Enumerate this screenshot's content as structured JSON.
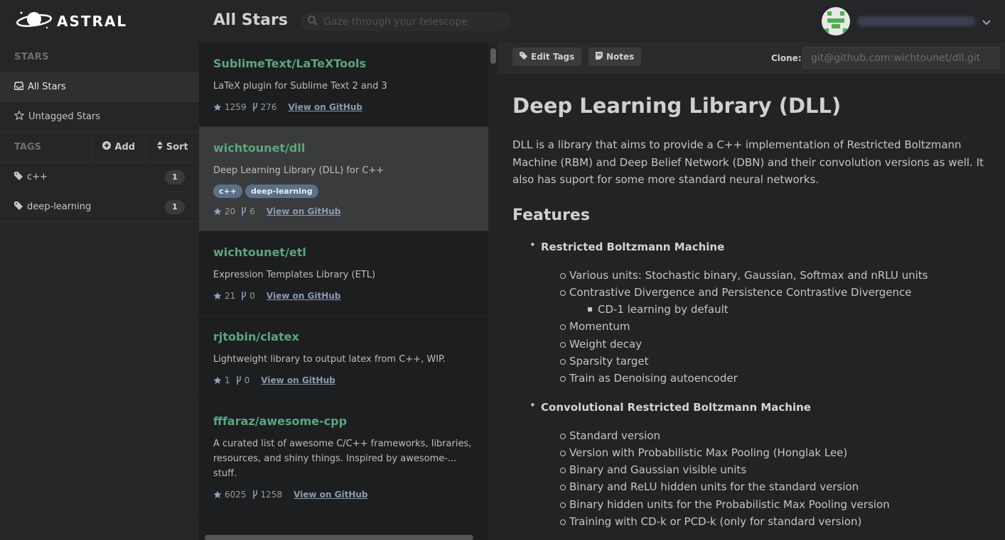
{
  "brand": {
    "name": "ASTRAL"
  },
  "header": {
    "title": "All Stars",
    "search_placeholder": "Gaze through your telescope"
  },
  "sidebar": {
    "stars_heading": "STARS",
    "items": [
      {
        "label": "All Stars",
        "icon": "inbox-icon",
        "active": true
      },
      {
        "label": "Untagged Stars",
        "icon": "star-outline-icon"
      }
    ],
    "tags_heading": "TAGS",
    "add_label": "Add",
    "sort_label": "Sort",
    "tags": [
      {
        "label": "c++",
        "count": "1"
      },
      {
        "label": "deep-learning",
        "count": "1"
      }
    ]
  },
  "repos": [
    {
      "name": "SublimeText/LaTeXTools",
      "description": "LaTeX plugin for Sublime Text 2 and 3",
      "stars": "1259",
      "forks": "276",
      "link": "View on GitHub",
      "tags": []
    },
    {
      "name": "wichtounet/dll",
      "description": "Deep Learning Library (DLL) for C++",
      "stars": "20",
      "forks": "6",
      "link": "View on GitHub",
      "tags": [
        "c++",
        "deep-learning"
      ],
      "selected": true
    },
    {
      "name": "wichtounet/etl",
      "description": "Expression Templates Library (ETL)",
      "stars": "21",
      "forks": "0",
      "link": "View on GitHub",
      "tags": []
    },
    {
      "name": "rjtobin/clatex",
      "description": "Lightweight library to output latex from C++, WIP.",
      "stars": "1",
      "forks": "0",
      "link": "View on GitHub",
      "tags": []
    },
    {
      "name": "fffaraz/awesome-cpp",
      "description": "A curated list of awesome C/C++ frameworks, libraries, resources, and shiny things. Inspired by awesome-... stuff.",
      "stars": "6025",
      "forks": "1258",
      "link": "View on GitHub",
      "tags": []
    }
  ],
  "detail": {
    "edit_tags_label": "Edit Tags",
    "notes_label": "Notes",
    "clone_label": "Clone:",
    "clone_url": "git@github.com:wichtounet/dll.git",
    "title": "Deep Learning Library (DLL)",
    "intro": "DLL is a library that aims to provide a C++ implementation of Restricted Boltzmann Machine (RBM) and Deep Belief Network (DBN) and their convolution versions as well. It also has suport for some more standard neural networks.",
    "features_heading": "Features",
    "sections": [
      {
        "title": "Restricted Boltzmann Machine",
        "items": [
          {
            "text": "Various units: Stochastic binary, Gaussian, Softmax and nRLU units"
          },
          {
            "text": "Contrastive Divergence and Persistence Contrastive Divergence",
            "sub": [
              "CD-1 learning by default"
            ]
          },
          {
            "text": "Momentum"
          },
          {
            "text": "Weight decay"
          },
          {
            "text": "Sparsity target"
          },
          {
            "text": "Train as Denoising autoencoder"
          }
        ]
      },
      {
        "title": "Convolutional Restricted Boltzmann Machine",
        "items": [
          {
            "text": "Standard version"
          },
          {
            "text": "Version with Probabilistic Max Pooling (Honglak Lee)"
          },
          {
            "text": "Binary and Gaussian visible units"
          },
          {
            "text": "Binary and ReLU hidden units for the standard version"
          },
          {
            "text": "Binary hidden units for the Probabilistic Max Pooling version"
          },
          {
            "text": "Training with CD-k or PCD-k (only for standard version)"
          }
        ]
      }
    ]
  },
  "colors": {
    "repo_name": "#5aa77d",
    "chip": "#5b7088",
    "link": "#8b9bb0"
  }
}
